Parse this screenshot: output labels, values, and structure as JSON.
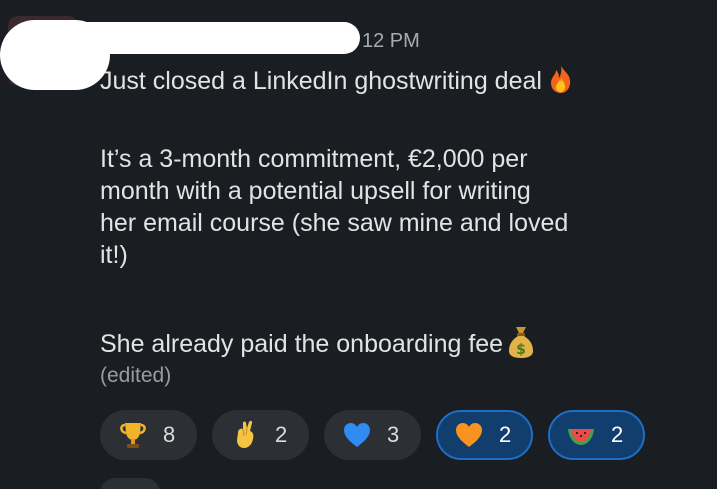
{
  "message": {
    "timestamp": "12 PM",
    "line1": "Just closed a LinkedIn ghostwriting deal",
    "para2": [
      "It’s a 3-month commitment, €2,000 per",
      "month with a potential upsell for writing",
      "her email course (she saw mine and loved",
      "it!)"
    ],
    "para3": "She already paid the onboarding fee",
    "edited": "(edited)",
    "emojis": {
      "line1_end": "fire-icon",
      "para3_end": "money-bag-icon"
    }
  },
  "reactions": [
    {
      "icon": "trophy-icon",
      "count": "8",
      "active": false
    },
    {
      "icon": "crossed-fingers-icon",
      "count": "2",
      "active": false
    },
    {
      "icon": "blue-heart-icon",
      "count": "3",
      "active": false
    },
    {
      "icon": "orange-heart-icon",
      "count": "2",
      "active": true
    },
    {
      "icon": "watermelon-icon",
      "count": "2",
      "active": true
    }
  ],
  "colors": {
    "background": "#1a1d21",
    "text": "#e3e3e3",
    "muted": "#9a9ca0",
    "reaction_bg": "#2c2f34",
    "reaction_active_bg": "#123e6e",
    "reaction_active_border": "#1d6fc6"
  }
}
